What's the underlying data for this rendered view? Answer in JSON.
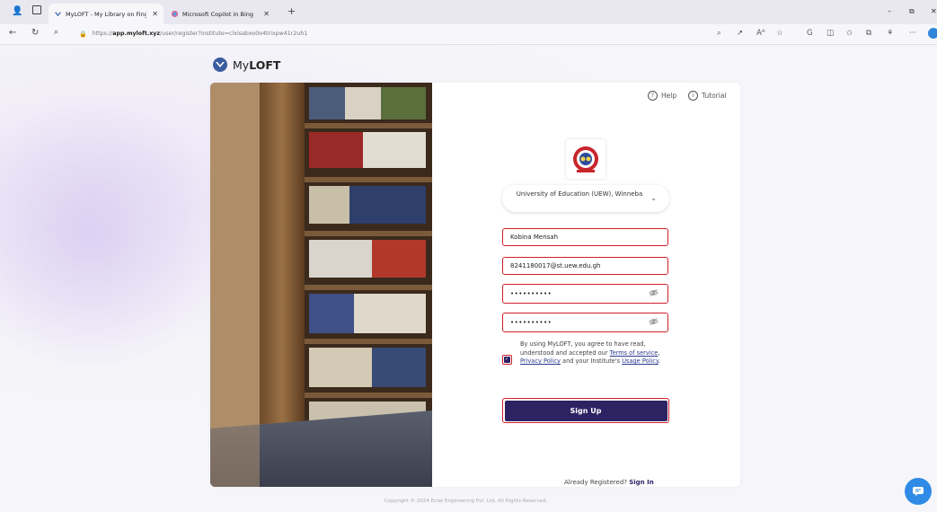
{
  "browser": {
    "tabs": [
      {
        "title": "MyLOFT - My Library on Finger T",
        "active": true
      },
      {
        "title": "Microsoft Copilot in Bing",
        "active": false
      }
    ],
    "url_prefix": "https://",
    "url_host": "app.myloft.xyz",
    "url_path": "/user/register?institute=clxisabxo0o4trixpw41r2uh1"
  },
  "brand": {
    "my": "My",
    "loft": "LOFT"
  },
  "header": {
    "help_label": "Help",
    "tutorial_label": "Tutorial"
  },
  "form": {
    "institute": "University of Education (UEW), Winneba",
    "name_value": "Kobina Mensah",
    "email_value": "8241180017@st.uew.edu.gh",
    "password_value": "••••••••••",
    "confirm_password_value": "••••••••••",
    "consent_prefix": "By using MyLOFT, you agree to have read, understood and accepted our ",
    "terms_link": "Terms of service",
    "consent_mid": ", ",
    "privacy_link": "Privacy Policy",
    "consent_mid2": " and your Institute's ",
    "usage_link": "Usage Policy",
    "consent_suffix": ".",
    "consent_checked": true,
    "signup_label": "Sign Up",
    "already_text": "Already Registered?",
    "signin_label": "Sign In"
  },
  "footer": {
    "copyright": "Copyright © 2024 Eclat Engineering Pvt. Ltd. All Rights Reserved."
  },
  "colors": {
    "primary": "#2d2363",
    "highlight": "#d11e2a",
    "chat": "#2f8be6"
  },
  "icons": [
    "profile-icon",
    "tab-actions-icon",
    "back-icon",
    "refresh-icon",
    "search-icon",
    "lock-icon",
    "help-icon",
    "info-icon",
    "eye-off-icon",
    "chevron-down-icon",
    "chat-icon"
  ]
}
